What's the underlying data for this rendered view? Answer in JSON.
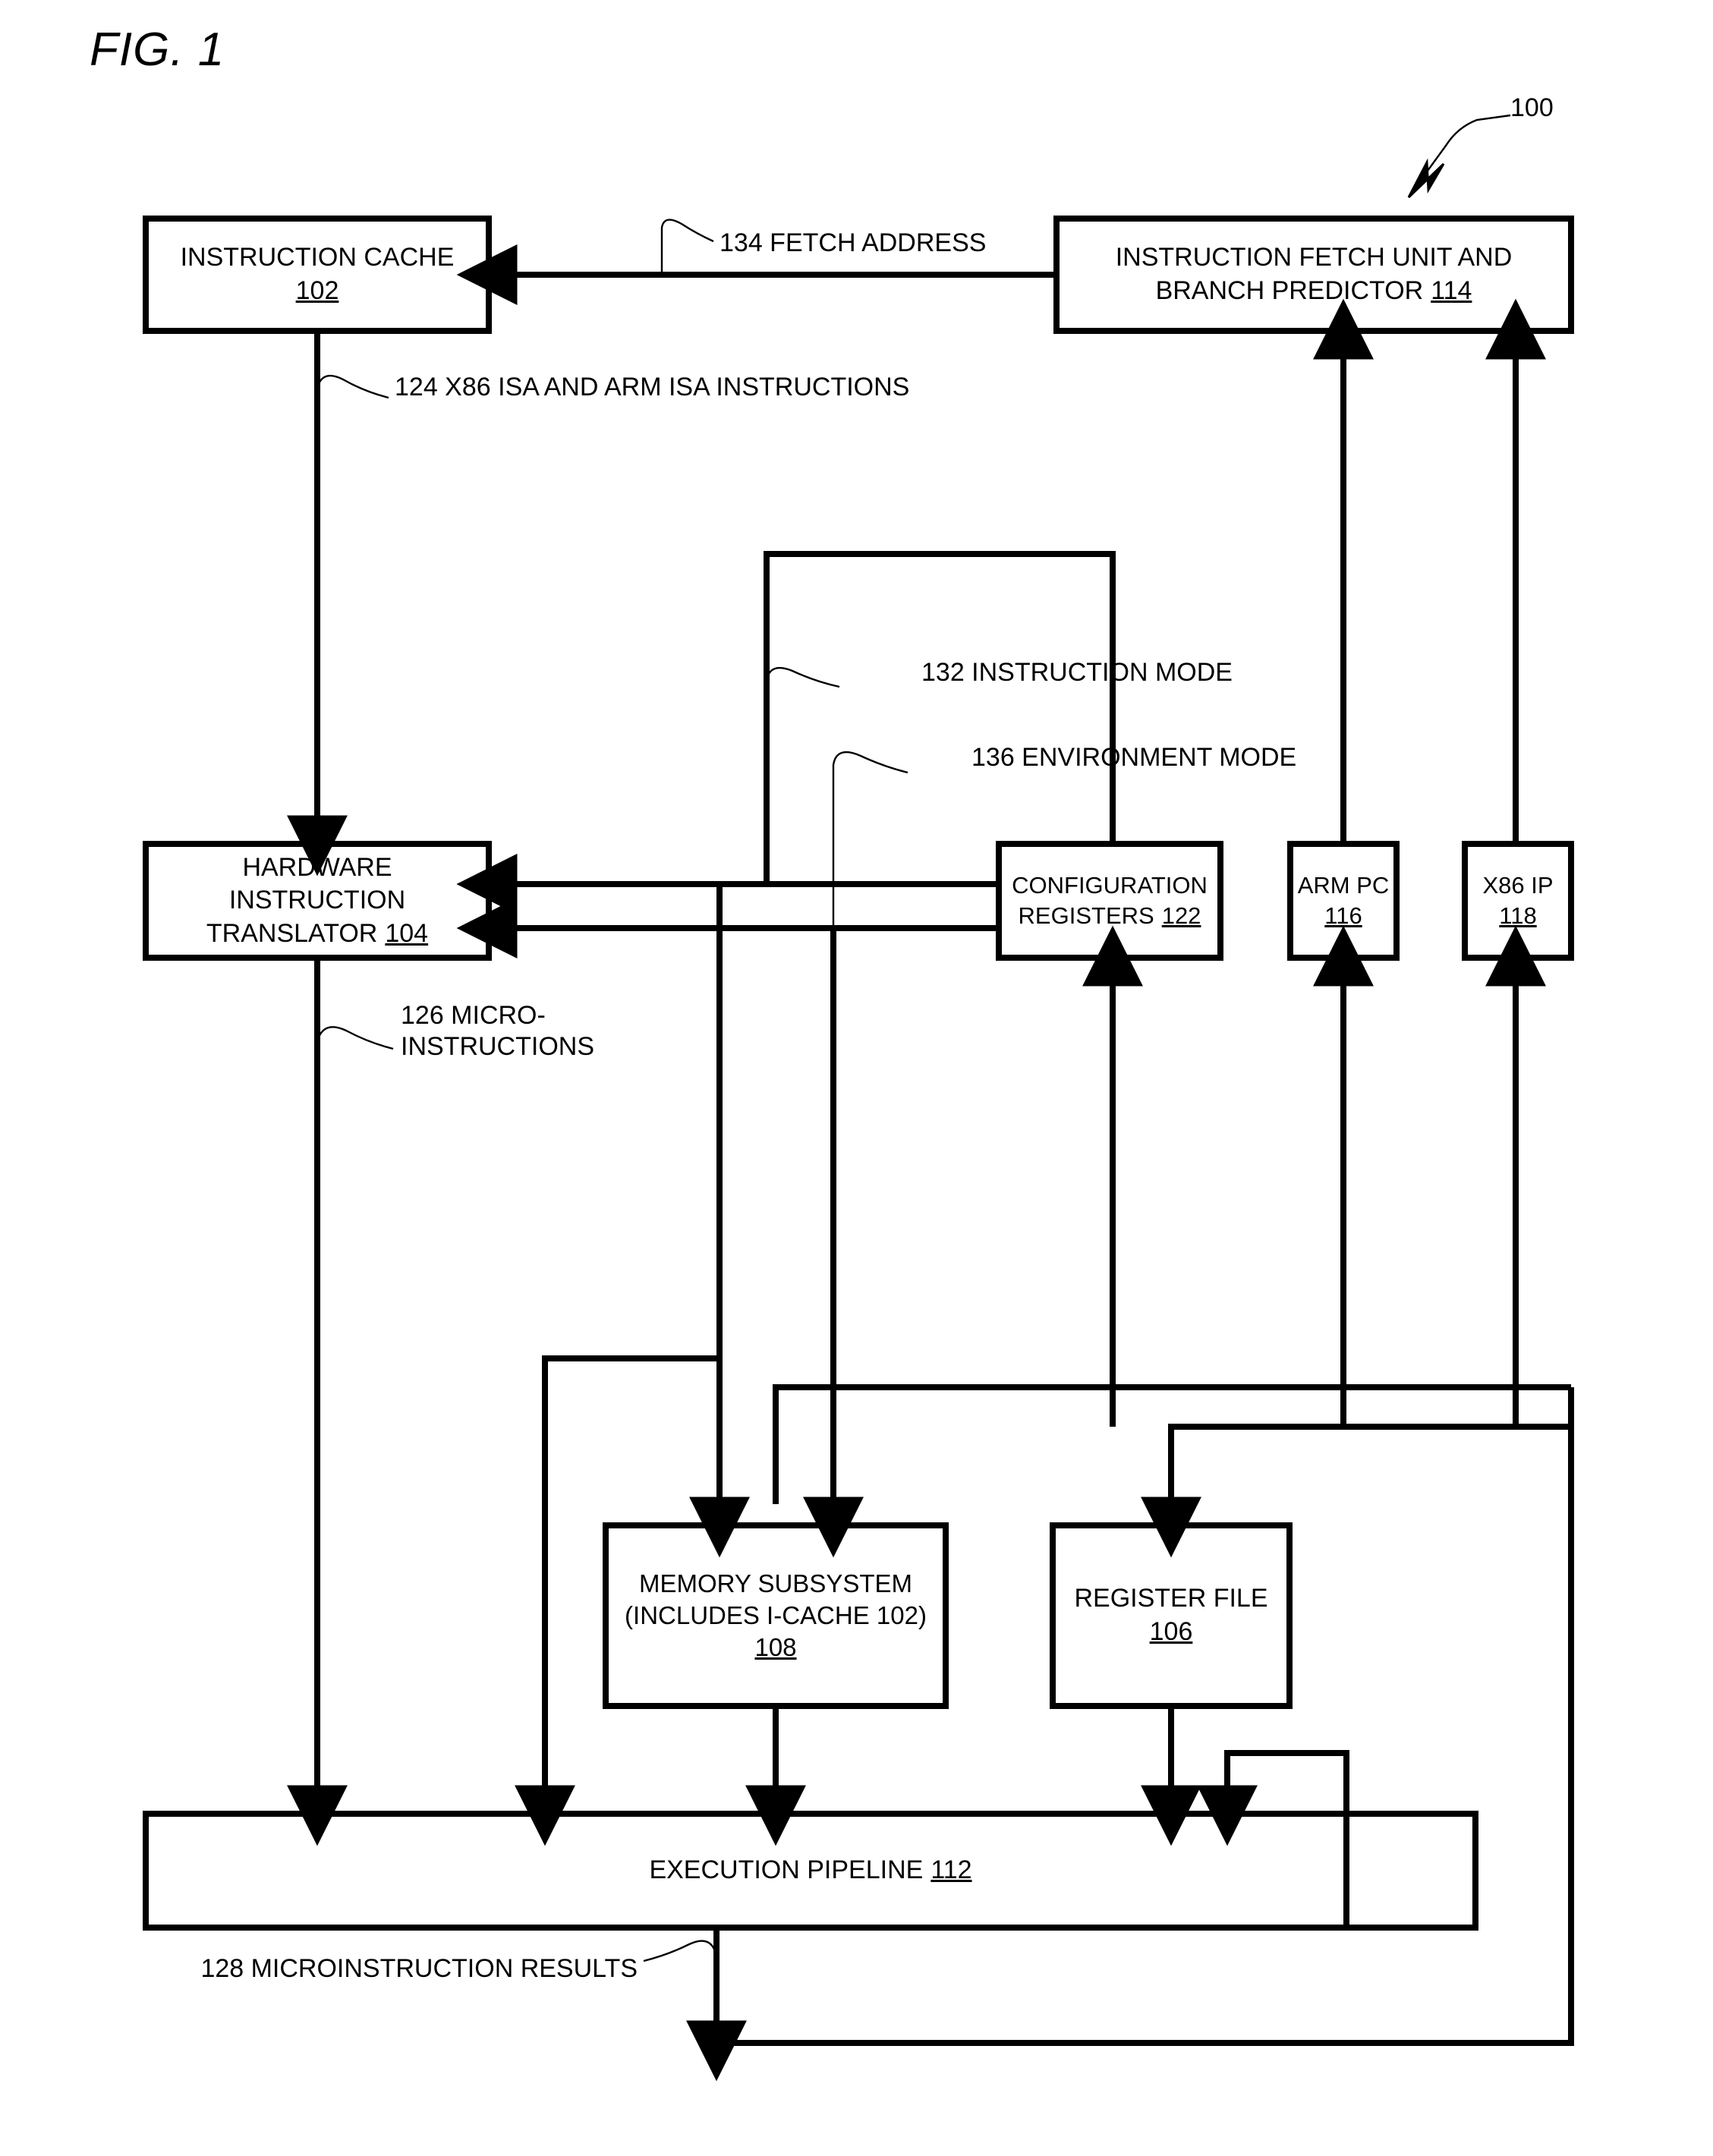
{
  "figure": {
    "title": "FIG. 1",
    "reference_numeral": "100"
  },
  "blocks": [
    {
      "id": "instruction-cache",
      "lines": [
        "INSTRUCTION CACHE"
      ],
      "ref": "102",
      "ref_inline": false
    },
    {
      "id": "instruction-fetch-unit",
      "lines": [
        "INSTRUCTION FETCH UNIT AND",
        "BRANCH PREDICTOR"
      ],
      "ref": "114",
      "ref_inline": true
    },
    {
      "id": "hardware-instruction-translator",
      "lines": [
        "HARDWARE",
        "INSTRUCTION",
        "TRANSLATOR"
      ],
      "ref": "104",
      "ref_inline": true
    },
    {
      "id": "configuration-registers",
      "lines": [
        "CONFIGURATION",
        "REGISTERS"
      ],
      "ref": "122",
      "ref_inline": true
    },
    {
      "id": "arm-pc",
      "lines": [
        "ARM PC"
      ],
      "ref": "116",
      "ref_inline": false
    },
    {
      "id": "x86-ip",
      "lines": [
        "X86 IP"
      ],
      "ref": "118",
      "ref_inline": false
    },
    {
      "id": "memory-subsystem",
      "lines": [
        "MEMORY SUBSYSTEM",
        "(INCLUDES I-CACHE 102)"
      ],
      "ref": "108",
      "ref_inline": false
    },
    {
      "id": "register-file",
      "lines": [
        "REGISTER FILE"
      ],
      "ref": "106",
      "ref_inline": false
    },
    {
      "id": "execution-pipeline",
      "lines": [
        "EXECUTION PIPELINE"
      ],
      "ref": "112",
      "ref_inline": true
    }
  ],
  "signals": [
    {
      "id": "fetch-address",
      "text": "134 FETCH ADDRESS"
    },
    {
      "id": "isa-instructions",
      "text": "124 X86 ISA AND ARM ISA INSTRUCTIONS"
    },
    {
      "id": "instruction-mode",
      "text": "132 INSTRUCTION MODE"
    },
    {
      "id": "environment-mode",
      "text": "136 ENVIRONMENT MODE"
    },
    {
      "id": "microinstructions",
      "line1": "126 MICRO-",
      "line2": "INSTRUCTIONS"
    },
    {
      "id": "microinstruction-results",
      "text": "128 MICROINSTRUCTION RESULTS"
    }
  ],
  "colors": {
    "ink": "#000000",
    "paper": "#ffffff"
  }
}
